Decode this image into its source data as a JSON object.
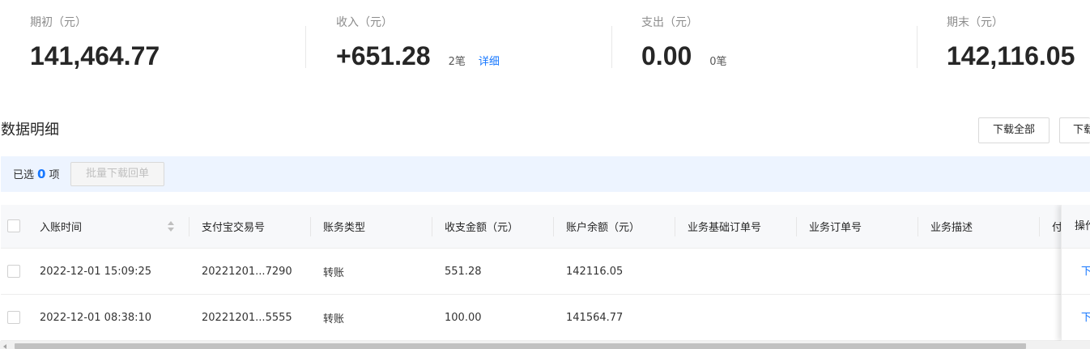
{
  "summary": {
    "opening": {
      "label": "期初（元）",
      "value": "141,464.77"
    },
    "income": {
      "label": "收入（元）",
      "value": "+651.28",
      "count": "2笔",
      "detail_link": "详细"
    },
    "expense": {
      "label": "支出（元）",
      "value": "0.00",
      "count": "0笔"
    },
    "closing": {
      "label": "期末（元）",
      "value": "142,116.05"
    }
  },
  "section": {
    "title": "数据明细",
    "download_all": "下载全部",
    "download_partial": "下载"
  },
  "selection": {
    "prefix": "已选",
    "count": "0",
    "suffix": "项",
    "batch_button": "批量下载回单"
  },
  "table": {
    "headers": [
      "入账时间",
      "支付宝交易号",
      "账务类型",
      "收支金额（元）",
      "账户余额（元）",
      "业务基础订单号",
      "业务订单号",
      "业务描述",
      "付"
    ],
    "action_header": "操作",
    "rows": [
      {
        "time": "2022-12-01 15:09:25",
        "trade_no": "20221201...7290",
        "type": "转账",
        "amount": "551.28",
        "balance": "142116.05",
        "base_order": "",
        "order": "",
        "desc": "",
        "action": "下"
      },
      {
        "time": "2022-12-01 08:38:10",
        "trade_no": "20221201...5555",
        "type": "转账",
        "amount": "100.00",
        "balance": "141564.77",
        "base_order": "",
        "order": "",
        "desc": "",
        "action": "下"
      }
    ]
  },
  "colors": {
    "accent": "#1677ff",
    "selection_bg": "#edf4ff",
    "header_bg": "#f7f8fa"
  }
}
